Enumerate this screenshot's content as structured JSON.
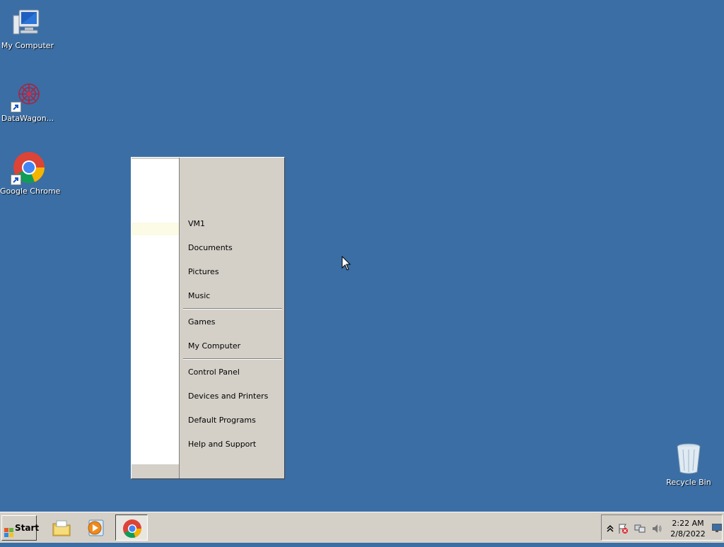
{
  "desktop": {
    "background": "#3a6ea5",
    "icons": [
      {
        "label": "My Computer",
        "icon": "computer-icon"
      },
      {
        "label": "DataWagon...",
        "icon": "datawagon-icon"
      },
      {
        "label": "Google Chrome",
        "icon": "chrome-icon"
      },
      {
        "label": "Recycle Bin",
        "icon": "recycle-bin-icon"
      }
    ]
  },
  "start_menu": {
    "items": [
      {
        "label": "VM1"
      },
      {
        "label": "Documents"
      },
      {
        "label": "Pictures"
      },
      {
        "label": "Music"
      },
      {
        "label": "Games"
      },
      {
        "label": "My Computer"
      },
      {
        "label": "Control Panel"
      },
      {
        "label": "Devices and Printers"
      },
      {
        "label": "Default Programs"
      },
      {
        "label": "Help and Support"
      }
    ]
  },
  "taskbar": {
    "start_label": "Start",
    "pinned": [
      {
        "icon": "file-explorer-icon"
      },
      {
        "icon": "media-player-icon"
      },
      {
        "icon": "chrome-icon"
      }
    ],
    "tray": {
      "icons": [
        "show-hidden-icons-icon",
        "action-center-flag-icon",
        "network-icon",
        "volume-icon"
      ]
    },
    "clock": {
      "time": "2:22 AM",
      "date": "2/8/2022"
    }
  }
}
